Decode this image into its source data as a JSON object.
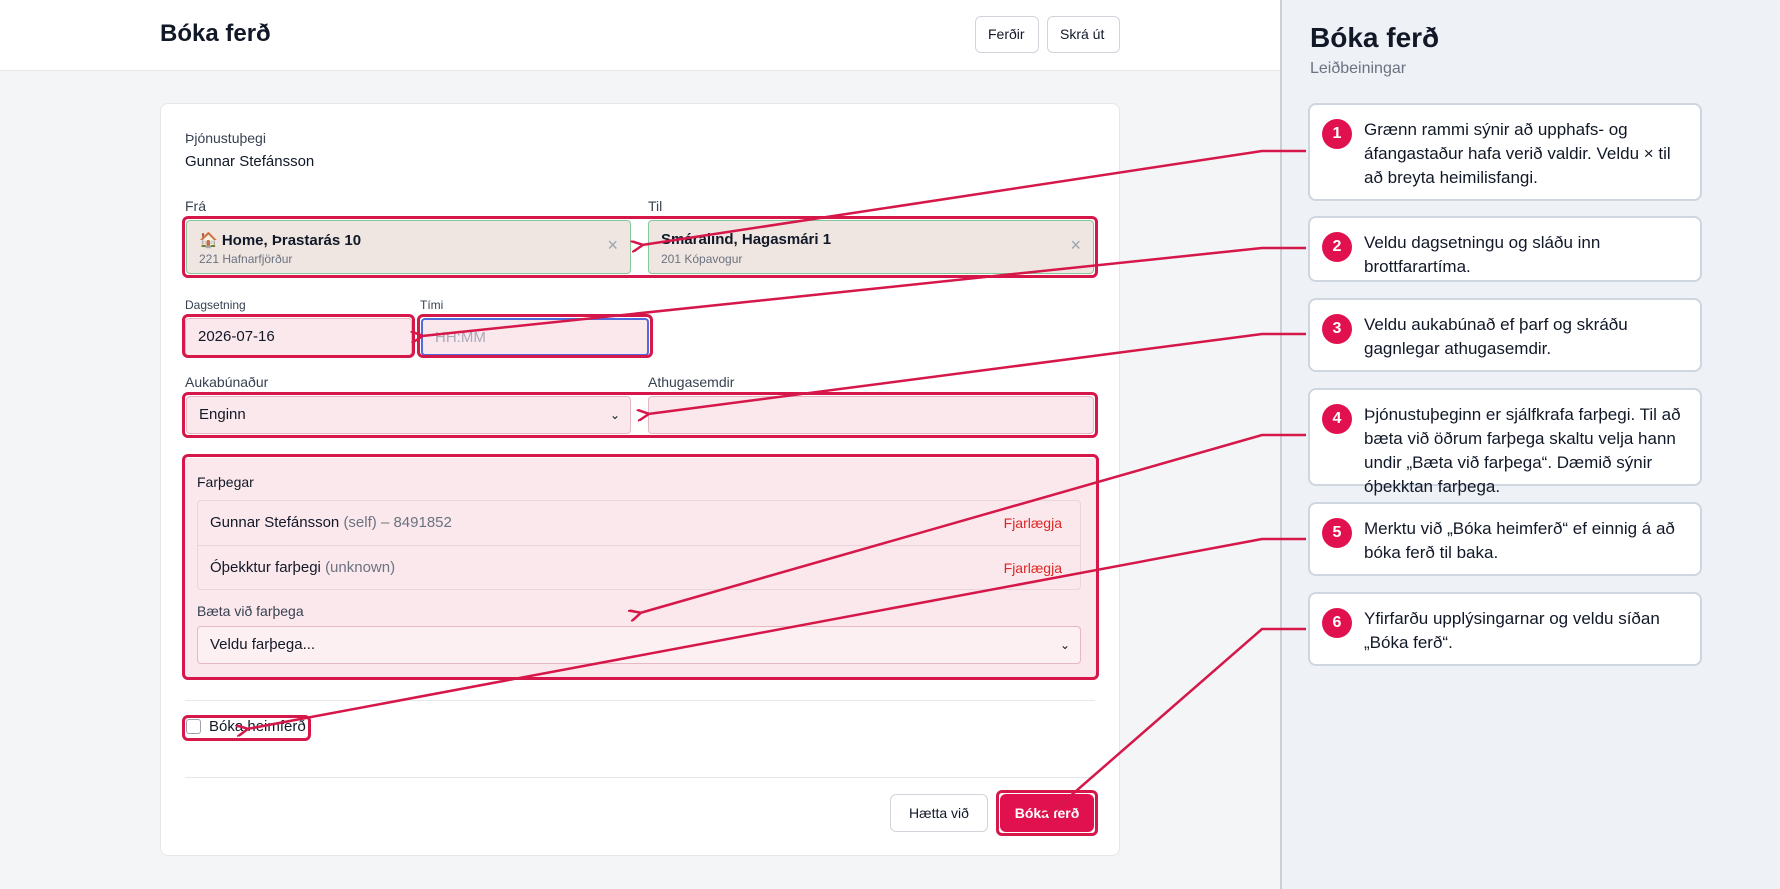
{
  "header": {
    "title": "Bóka ferð",
    "nav_trips": "Ferðir",
    "logout": "Skrá út"
  },
  "form": {
    "client_label": "Þjónustuþegi",
    "client_name": "Gunnar Stefánsson",
    "from_label": "Frá",
    "from_icon": "house-emoji",
    "from_main": "🏠 Home, Þrastarás 10",
    "from_sub": "221 Hafnarfjörður",
    "to_label": "Til",
    "to_main": "Smáralind, Hagasmári 1",
    "to_sub": "201 Kópavogur",
    "clear_symbol": "×",
    "date_label": "Dagsetning",
    "date_value": "2026-07-16",
    "time_label": "Tími",
    "time_placeholder": "HH:MM",
    "equipment_label": "Aukabúnaður",
    "equipment_value": "Enginn",
    "notes_label": "Athugasemdir",
    "notes_value": "",
    "passengers_title": "Farþegar",
    "passengers": [
      {
        "name": "Gunnar Stefánsson",
        "meta": "(self) – 8491852",
        "remove": "Fjarlægja"
      },
      {
        "name": "Óþekktur farþegi",
        "meta": "(unknown)",
        "remove": "Fjarlægja"
      }
    ],
    "add_passenger_label": "Bæta við farþega",
    "add_passenger_placeholder": "Veldu farþega...",
    "return_trip_label": "Bóka heimferð",
    "return_trip_checked": false,
    "cancel_button": "Hætta við",
    "submit_button": "Bóka ferð"
  },
  "guide": {
    "title": "Bóka ferð",
    "subtitle": "Leiðbeiningar",
    "steps": [
      {
        "num": "1",
        "text": "Grænn rammi sýnir að upphafs- og áfangastaður hafa verið valdir. Veldu × til að breyta heimilisfangi."
      },
      {
        "num": "2",
        "text": "Veldu dagsetningu og sláðu inn brottfarartíma."
      },
      {
        "num": "3",
        "text": "Veldu aukabúnað ef þarf og skráðu gagnlegar athugasemdir."
      },
      {
        "num": "4",
        "text": "Þjónustuþeginn er sjálfkrafa farþegi. Til að bæta við öðrum farþega skaltu velja hann undir „Bæta við farþega“. Dæmið sýnir óþekktan farþega."
      },
      {
        "num": "5",
        "text": "Merktu við „Bóka heimferð“ ef einnig á að bóka ferð til baka."
      },
      {
        "num": "6",
        "text": "Yfirfarðu upplýsingarnar og veldu síðan „Bóka ferð“."
      }
    ]
  },
  "colors": {
    "accent": "#e1114f",
    "highlight": "#d6174a",
    "selected_border": "#86c89b",
    "focus": "#4f6bdc"
  }
}
